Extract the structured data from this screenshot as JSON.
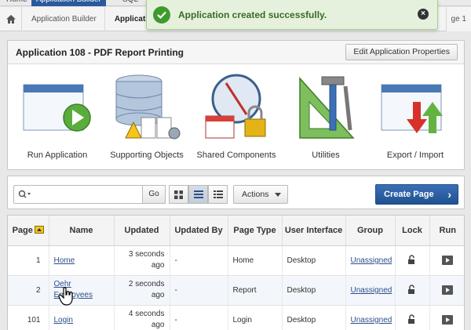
{
  "tabs": [
    {
      "label": "Home"
    },
    {
      "label": "Application Builder"
    },
    {
      "label": "SQL"
    }
  ],
  "breadcrumb": {
    "items": [
      "Application Builder",
      "Applicatio"
    ],
    "page_fragment": "ge 1"
  },
  "notification": {
    "message": "Application created successfully.",
    "close_label": "×",
    "status_color": "#3f9a2e"
  },
  "app": {
    "title": "Application 108 - PDF Report Printing",
    "edit_button": "Edit Application Properties",
    "tiles": [
      {
        "label": "Run Application",
        "icon": "run-application-icon"
      },
      {
        "label": "Supporting Objects",
        "icon": "supporting-objects-icon"
      },
      {
        "label": "Shared Components",
        "icon": "shared-components-icon"
      },
      {
        "label": "Utilities",
        "icon": "utilities-icon"
      },
      {
        "label": "Export / Import",
        "icon": "export-import-icon"
      }
    ]
  },
  "toolbar": {
    "search_value": "",
    "go_label": "Go",
    "actions_label": "Actions",
    "create_label": "Create Page",
    "accent_color": "#20528f"
  },
  "table": {
    "columns": [
      "Page",
      "Name",
      "Updated",
      "Updated By",
      "Page Type",
      "User Interface",
      "Group",
      "Lock",
      "Run"
    ],
    "rows": [
      {
        "page": "1",
        "name": "Home",
        "updated": "3 seconds ago",
        "updated_by": "-",
        "page_type": "Home",
        "ui": "Desktop",
        "group": "Unassigned"
      },
      {
        "page": "2",
        "name": "Oehr Employees",
        "updated": "2 seconds ago",
        "updated_by": "-",
        "page_type": "Report",
        "ui": "Desktop",
        "group": "Unassigned"
      },
      {
        "page": "101",
        "name": "Login",
        "updated": "4 seconds ago",
        "updated_by": "-",
        "page_type": "Login",
        "ui": "Desktop",
        "group": "Unassigned"
      }
    ]
  }
}
